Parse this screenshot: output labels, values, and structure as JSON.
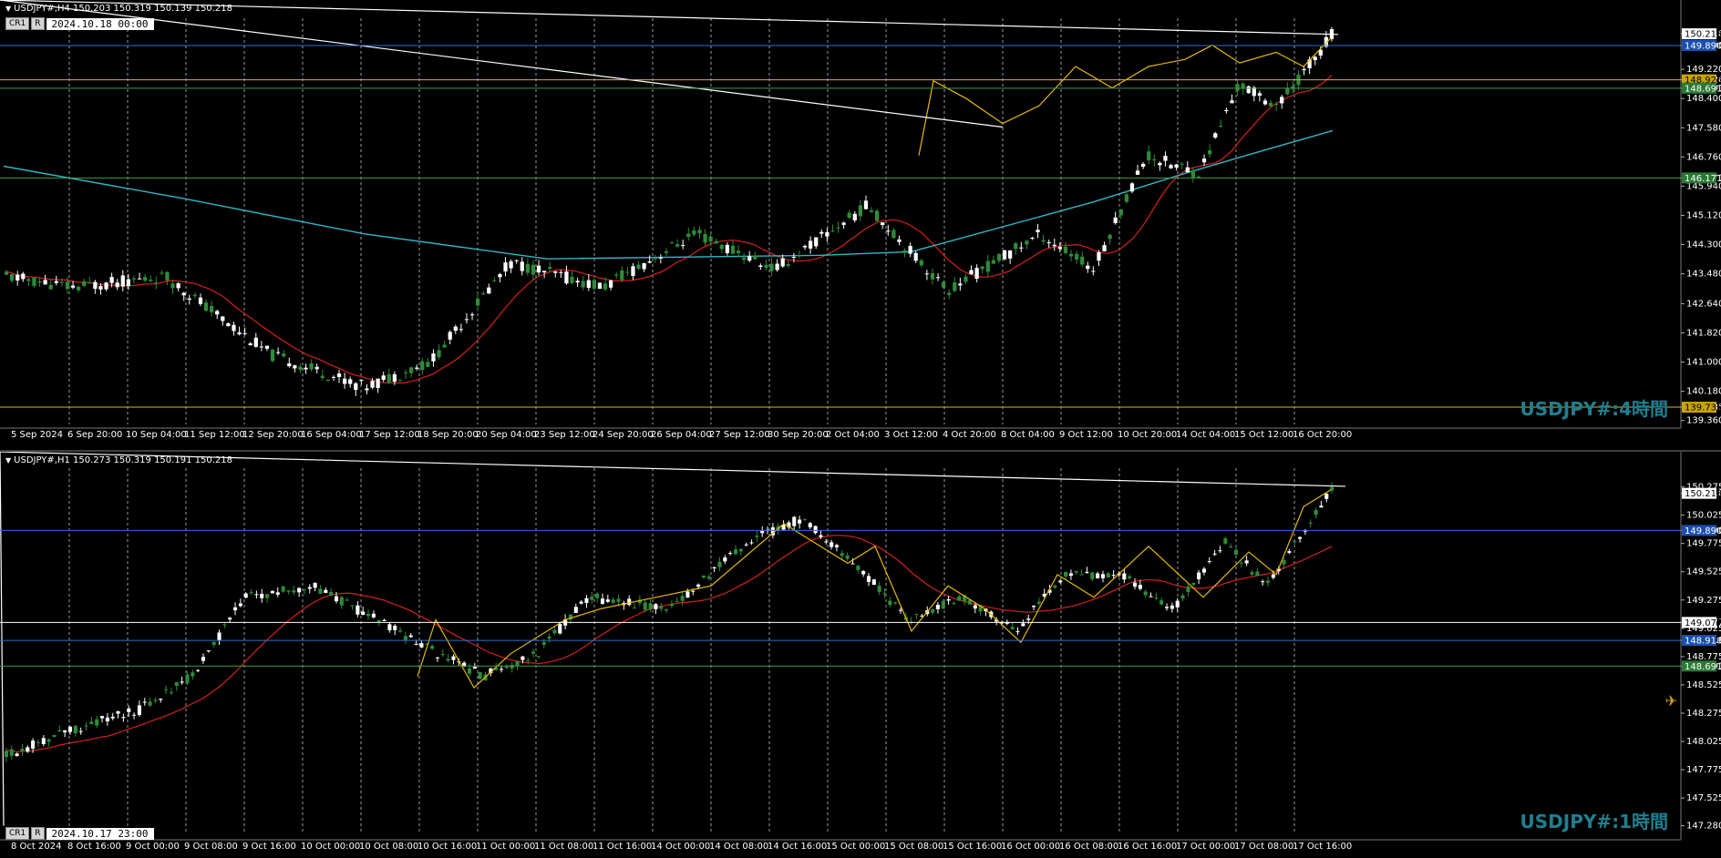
{
  "top": {
    "header": "USDJPY#,H4  150.203 150.319 150.139 150.218",
    "cr_label": "CR1",
    "r_label": "R",
    "date": "2024.10.18 00:00",
    "tf_label": "USDJPY#:4時間",
    "y_ticks": [
      "150.218",
      "149.890",
      "149.220",
      "148.926",
      "148.691",
      "148.400",
      "147.580",
      "146.760",
      "146.171",
      "145.940",
      "145.120",
      "144.300",
      "143.480",
      "142.640",
      "141.820",
      "141.000",
      "140.180",
      "139.735",
      "139.360"
    ],
    "x_ticks": [
      "5 Sep 2024",
      "6 Sep 20:00",
      "10 Sep 04:00",
      "11 Sep 12:00",
      "12 Sep 20:00",
      "16 Sep 04:00",
      "17 Sep 12:00",
      "18 Sep 20:00",
      "20 Sep 04:00",
      "23 Sep 12:00",
      "24 Sep 20:00",
      "26 Sep 04:00",
      "27 Sep 12:00",
      "30 Sep 20:00",
      "2 Oct 04:00",
      "3 Oct 12:00",
      "4 Oct 20:00",
      "8 Oct 04:00",
      "9 Oct 12:00",
      "10 Oct 20:00",
      "14 Oct 04:00",
      "15 Oct 12:00",
      "16 Oct 20:00"
    ],
    "levels": [
      {
        "value": "149.890",
        "color": "#2f6fd6",
        "fill": "#1a4fb0"
      },
      {
        "value": "148.926",
        "color": "#d6b52a",
        "fill": "#c9a400"
      },
      {
        "value": "148.691",
        "color": "#3f9a4a",
        "fill": "#2a7a35"
      },
      {
        "value": "146.171",
        "color": "#3f9a4a",
        "fill": "#2a7a35"
      },
      {
        "value": "139.735",
        "color": "#d6b52a",
        "fill": "#c9a400"
      }
    ],
    "current": "150.218"
  },
  "bottom": {
    "header": "USDJPY#,H1  150.273 150.319 150.191 150.218",
    "cr_label": "CR1",
    "r_label": "R",
    "date": "2024.10.17 23:00",
    "tf_label": "USDJPY#:1時間",
    "y_ticks": [
      "150.275",
      "150.218",
      "150.025",
      "149.890",
      "149.775",
      "149.525",
      "149.275",
      "149.077",
      "149.025",
      "148.918",
      "148.775",
      "148.691",
      "148.525",
      "148.275",
      "148.025",
      "147.775",
      "147.525",
      "147.280"
    ],
    "x_ticks": [
      "8 Oct 2024",
      "8 Oct 16:00",
      "9 Oct 00:00",
      "9 Oct 08:00",
      "9 Oct 16:00",
      "10 Oct 00:00",
      "10 Oct 08:00",
      "10 Oct 16:00",
      "11 Oct 00:00",
      "11 Oct 08:00",
      "11 Oct 16:00",
      "14 Oct 00:00",
      "14 Oct 08:00",
      "14 Oct 16:00",
      "15 Oct 00:00",
      "15 Oct 08:00",
      "15 Oct 16:00",
      "16 Oct 00:00",
      "16 Oct 08:00",
      "16 Oct 16:00",
      "17 Oct 00:00",
      "17 Oct 08:00",
      "17 Oct 16:00"
    ],
    "levels": [
      {
        "value": "149.890",
        "color": "#2f6fd6",
        "fill": "#1a4fb0"
      },
      {
        "value": "149.077",
        "color": "#ffffff",
        "fill": "#ffffff"
      },
      {
        "value": "148.918",
        "color": "#2f6fd6",
        "fill": "#1a4fb0"
      },
      {
        "value": "148.691",
        "color": "#3f9a4a",
        "fill": "#2a7a35"
      }
    ],
    "current": "150.218"
  },
  "colors": {
    "bull": "#2e8b3a",
    "bear": "#ffffff",
    "ma_red": "#d42020",
    "ma_cyan": "#30b7c7",
    "zigzag": "#e6b800",
    "trend": "#ffffff"
  }
}
